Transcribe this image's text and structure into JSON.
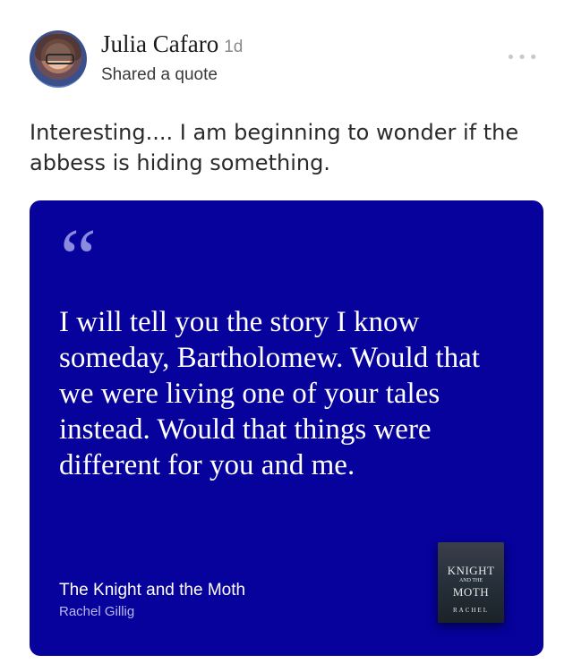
{
  "post": {
    "author_name": "Julia Cafaro",
    "time": "1d",
    "subtitle": "Shared a quote",
    "more_icon_text": "•••",
    "text": "Interesting.... I am beginning to wonder if the abbess is hiding something."
  },
  "quote": {
    "mark": "“",
    "text": "I will tell you the story I know someday, Bartholomew. Would that we were living one of your tales instead. Would that things were different for you and me.",
    "book_title": "The Knight and the Moth",
    "book_author": "Rachel Gillig",
    "card_color": "#06029b"
  },
  "cover": {
    "title_top": "KNIGHT",
    "title_small": "AND THE",
    "title_bottom": "MOTH",
    "author": "RACHEL"
  }
}
